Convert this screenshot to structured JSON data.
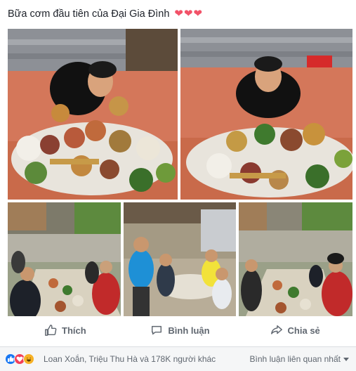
{
  "post": {
    "caption": "Bữa cơm đầu tiên của Đại Gia Đình",
    "hearts": "❤❤❤"
  },
  "photos": [
    {
      "name": "photo-man-with-feast-1"
    },
    {
      "name": "photo-man-with-feast-2"
    },
    {
      "name": "photo-family-table-1"
    },
    {
      "name": "photo-family-group-standing"
    },
    {
      "name": "photo-family-table-2"
    }
  ],
  "actions": {
    "like_label": "Thích",
    "comment_label": "Bình luận",
    "share_label": "Chia sẻ"
  },
  "footer": {
    "reaction_icons": [
      "like-icon",
      "love-icon",
      "haha-icon"
    ],
    "reactors_text": "Loan Xoắn, Triệu Thu Hà và 178K người khác",
    "sort_label": "Bình luận liên quan nhất"
  },
  "colors": {
    "like_blue": "#1877f2",
    "love_red": "#f33e58",
    "haha_yellow": "#f7b125",
    "text_gray": "#606770"
  }
}
